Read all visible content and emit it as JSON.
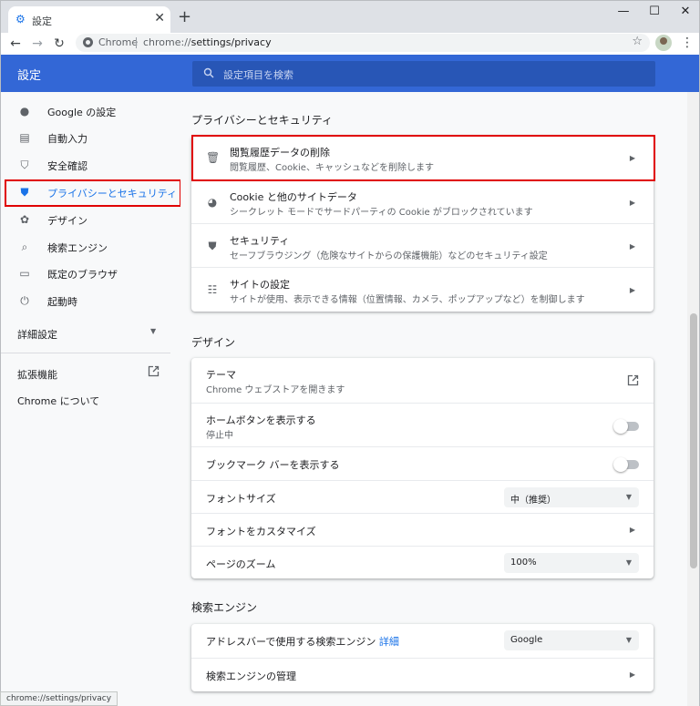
{
  "tab": {
    "title": "設定",
    "close": "✕",
    "new_tab": "+"
  },
  "window_controls": {
    "minimize": "—",
    "maximize": "☐",
    "close": "✕"
  },
  "toolbar": {
    "back": "←",
    "forward": "→",
    "reload": "↻",
    "site_label": "Chrome",
    "url_scheme": "chrome://",
    "url_path": "settings/privacy",
    "star": "☆",
    "menu": "⋮"
  },
  "header": {
    "title": "設定",
    "search_placeholder": "設定項目を検索"
  },
  "sidebar": {
    "items": [
      {
        "label": "Google の設定",
        "icon": "person-icon"
      },
      {
        "label": "自動入力",
        "icon": "clipboard-icon"
      },
      {
        "label": "安全確認",
        "icon": "shield-check-icon"
      },
      {
        "label": "プライバシーとセキュリティ",
        "icon": "shield-icon",
        "active": true
      },
      {
        "label": "デザイン",
        "icon": "palette-icon"
      },
      {
        "label": "検索エンジン",
        "icon": "search-icon"
      },
      {
        "label": "既定のブラウザ",
        "icon": "browser-icon"
      },
      {
        "label": "起動時",
        "icon": "power-icon"
      }
    ],
    "advanced": "詳細設定",
    "extensions": "拡張機能",
    "about": "Chrome について"
  },
  "privacy": {
    "title": "プライバシーとセキュリティ",
    "rows": [
      {
        "title": "閲覧履歴データの削除",
        "sub": "閲覧履歴、Cookie、キャッシュなどを削除します",
        "icon": "trash-icon"
      },
      {
        "title": "Cookie と他のサイトデータ",
        "sub": "シークレット モードでサードパーティの Cookie がブロックされています",
        "icon": "cookie-icon"
      },
      {
        "title": "セキュリティ",
        "sub": "セーフブラウジング（危険なサイトからの保護機能）などのセキュリティ設定",
        "icon": "shield-icon"
      },
      {
        "title": "サイトの設定",
        "sub": "サイトが使用、表示できる情報（位置情報、カメラ、ポップアップなど）を制御します",
        "icon": "sliders-icon"
      }
    ]
  },
  "design": {
    "title": "デザイン",
    "theme_title": "テーマ",
    "theme_sub": "Chrome ウェブストアを開きます",
    "home_title": "ホームボタンを表示する",
    "home_sub": "停止中",
    "bookmarks_title": "ブックマーク バーを表示する",
    "font_size_label": "フォントサイズ",
    "font_size_value": "中（推奨）",
    "customize_fonts": "フォントをカスタマイズ",
    "zoom_label": "ページのズーム",
    "zoom_value": "100%"
  },
  "search": {
    "title": "検索エンジン",
    "engine_label": "アドレスバーで使用する検索エンジン",
    "engine_link": "詳細",
    "engine_value": "Google",
    "manage": "検索エンジンの管理"
  },
  "status_url": "chrome://settings/privacy",
  "colors": {
    "accent": "#1a73e8",
    "header": "#3367d6",
    "highlight": "#e00000"
  }
}
